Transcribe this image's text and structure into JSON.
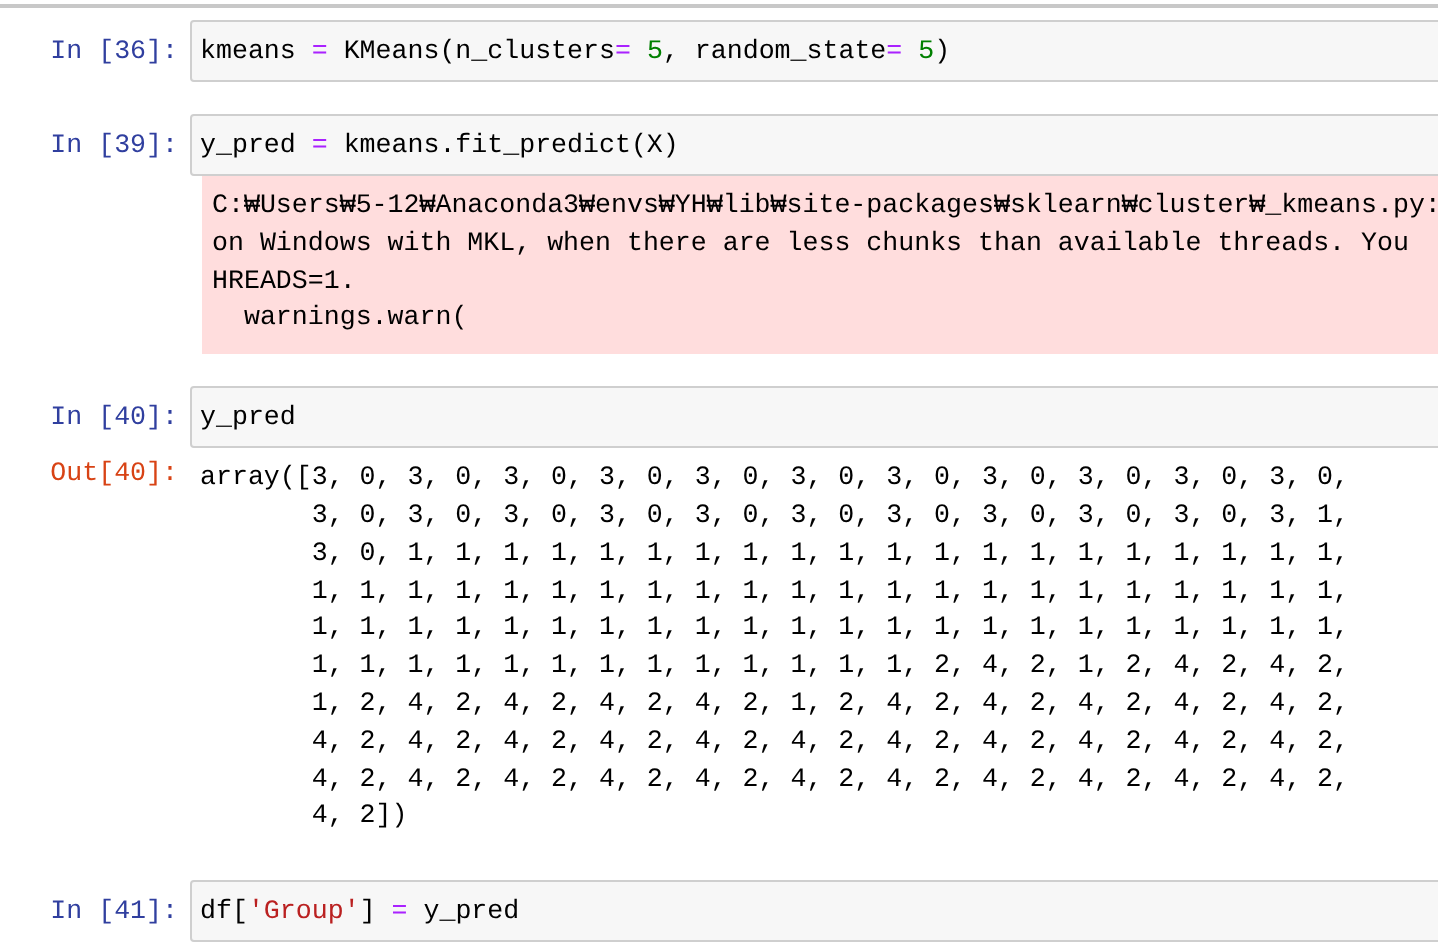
{
  "cells": [
    {
      "prompt": "In [36]:",
      "code": [
        [
          {
            "kind": "plain",
            "text": "kmeans "
          },
          {
            "kind": "op",
            "text": "="
          },
          {
            "kind": "plain",
            "text": " KMeans(n_clusters"
          },
          {
            "kind": "op",
            "text": "="
          },
          {
            "kind": "num",
            "text": " 5"
          },
          {
            "kind": "plain",
            "text": ", random_state"
          },
          {
            "kind": "op",
            "text": "="
          },
          {
            "kind": "num",
            "text": " 5"
          },
          {
            "kind": "plain",
            "text": ")"
          }
        ]
      ]
    },
    {
      "prompt": "In [39]:",
      "code": [
        [
          {
            "kind": "plain",
            "text": "y_pred "
          },
          {
            "kind": "op",
            "text": "="
          },
          {
            "kind": "plain",
            "text": " kmeans.fit_predict(X)"
          }
        ]
      ],
      "output": {
        "kind": "stderr",
        "lines": [
          "C:₩Users₩5-12₩Anaconda3₩envs₩YH₩lib₩site-packages₩sklearn₩cluster₩_kmeans.py:",
          "on Windows with MKL, when there are less chunks than available threads. You",
          "HREADS=1.",
          "  warnings.warn("
        ]
      }
    },
    {
      "prompt": "In [40]:",
      "code": [
        [
          {
            "kind": "plain",
            "text": "y_pred"
          }
        ]
      ],
      "output": {
        "kind": "result",
        "prompt": "Out[40]:",
        "lines": [
          "array([3, 0, 3, 0, 3, 0, 3, 0, 3, 0, 3, 0, 3, 0, 3, 0, 3, 0, 3, 0, 3, 0,",
          "       3, 0, 3, 0, 3, 0, 3, 0, 3, 0, 3, 0, 3, 0, 3, 0, 3, 0, 3, 0, 3, 1,",
          "       3, 0, 1, 1, 1, 1, 1, 1, 1, 1, 1, 1, 1, 1, 1, 1, 1, 1, 1, 1, 1, 1,",
          "       1, 1, 1, 1, 1, 1, 1, 1, 1, 1, 1, 1, 1, 1, 1, 1, 1, 1, 1, 1, 1, 1,",
          "       1, 1, 1, 1, 1, 1, 1, 1, 1, 1, 1, 1, 1, 1, 1, 1, 1, 1, 1, 1, 1, 1,",
          "       1, 1, 1, 1, 1, 1, 1, 1, 1, 1, 1, 1, 1, 2, 4, 2, 1, 2, 4, 2, 4, 2,",
          "       1, 2, 4, 2, 4, 2, 4, 2, 4, 2, 1, 2, 4, 2, 4, 2, 4, 2, 4, 2, 4, 2,",
          "       4, 2, 4, 2, 4, 2, 4, 2, 4, 2, 4, 2, 4, 2, 4, 2, 4, 2, 4, 2, 4, 2,",
          "       4, 2, 4, 2, 4, 2, 4, 2, 4, 2, 4, 2, 4, 2, 4, 2, 4, 2, 4, 2, 4, 2,",
          "       4, 2])"
        ]
      }
    },
    {
      "prompt": "In [41]:",
      "code": [
        [
          {
            "kind": "plain",
            "text": "df["
          },
          {
            "kind": "str",
            "text": "'Group'"
          },
          {
            "kind": "plain",
            "text": "] "
          },
          {
            "kind": "op",
            "text": "="
          },
          {
            "kind": "plain",
            "text": " y_pred"
          }
        ]
      ]
    }
  ]
}
